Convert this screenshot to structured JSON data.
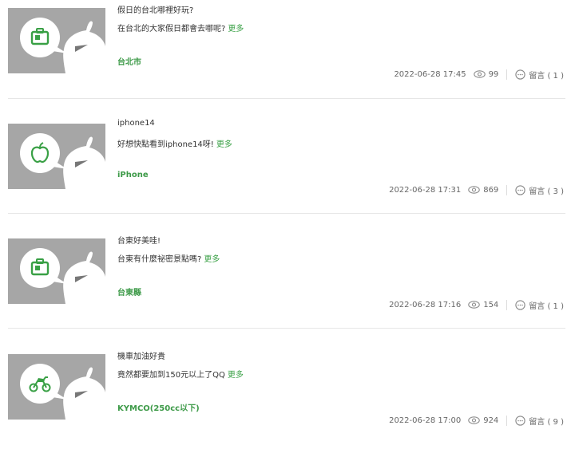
{
  "colors": {
    "accent": "#39a045",
    "thumb_bg": "#a6a6a6"
  },
  "posts": [
    {
      "title": "假日的台北哪裡好玩?",
      "excerpt": "在台北的大家假日都會去哪呢?",
      "more": "更多",
      "tag": "台北市",
      "date": "2022-06-28 17:45",
      "views": "99",
      "comments": "留言 ( 1 )",
      "thumb_icon": "suitcase-icon"
    },
    {
      "title": "iphone14",
      "excerpt": "好想快點看到iphone14呀!",
      "more": "更多",
      "tag": "iPhone",
      "date": "2022-06-28 17:31",
      "views": "869",
      "comments": "留言 ( 3 )",
      "thumb_icon": "apple-icon"
    },
    {
      "title": "台東好美哇!",
      "excerpt": "台東有什麼祕密景點嗎?",
      "more": "更多",
      "tag": "台東縣",
      "date": "2022-06-28 17:16",
      "views": "154",
      "comments": "留言 ( 1 )",
      "thumb_icon": "suitcase-icon"
    },
    {
      "title": "機車加油好貴",
      "excerpt": "竟然都要加到150元以上了QQ",
      "more": "更多",
      "tag": "KYMCO(250cc以下)",
      "date": "2022-06-28 17:00",
      "views": "924",
      "comments": "留言 ( 9 )",
      "thumb_icon": "motorcycle-icon"
    }
  ]
}
